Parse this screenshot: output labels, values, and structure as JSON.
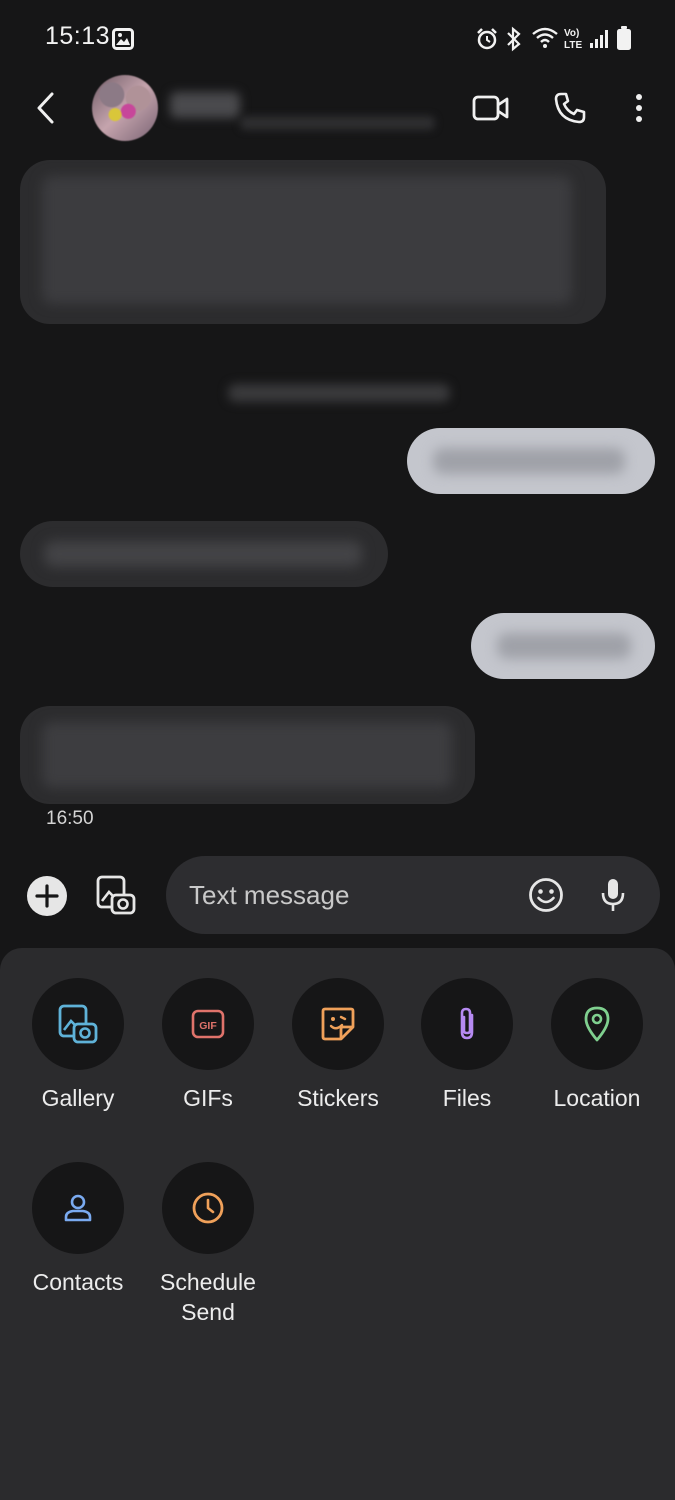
{
  "status_bar": {
    "time": "15:13",
    "icons": [
      "gallery-notification-icon",
      "alarm-icon",
      "bluetooth-icon",
      "wifi-icon",
      "volte-icon",
      "signal-icon",
      "battery-icon"
    ]
  },
  "app_bar": {
    "icons": [
      "back-icon",
      "video-call-icon",
      "phone-icon",
      "more-options-icon"
    ]
  },
  "conversation": {
    "last_timestamp": "16:50"
  },
  "composer": {
    "placeholder": "Text message",
    "icons": [
      "add-icon",
      "gallery-camera-icon",
      "emoji-icon",
      "microphone-icon"
    ]
  },
  "attach_panel": {
    "options": [
      {
        "label": "Gallery",
        "icon": "gallery-icon",
        "color": "#5fb2d8"
      },
      {
        "label": "GIFs",
        "icon": "gif-icon",
        "color": "#e0736b"
      },
      {
        "label": "Stickers",
        "icon": "sticker-icon",
        "color": "#f0a15a"
      },
      {
        "label": "Files",
        "icon": "paperclip-icon",
        "color": "#b68af2"
      },
      {
        "label": "Location",
        "icon": "location-pin-icon",
        "color": "#7fd08f"
      },
      {
        "label": "Contacts",
        "icon": "contact-icon",
        "color": "#7aaaf0"
      },
      {
        "label": "Schedule\nSend",
        "icon": "clock-icon",
        "color": "#f0a15a"
      }
    ]
  },
  "colors": {
    "background": "#161617",
    "incoming_bubble": "#2c2c2e",
    "outgoing_bubble": "#c4c6cd",
    "panel": "#2b2b2d"
  }
}
